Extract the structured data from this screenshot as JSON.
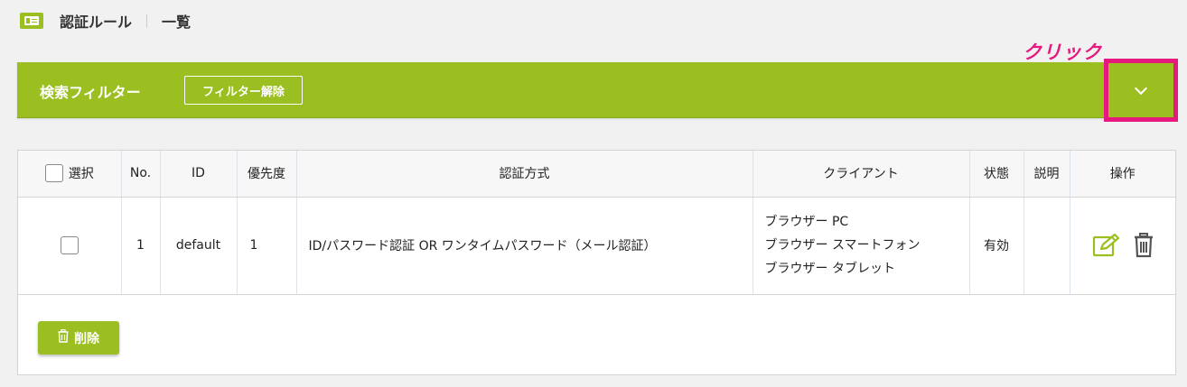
{
  "header": {
    "title": "認証ルール",
    "subtitle": "一覧"
  },
  "annotation": {
    "click_label": "クリック",
    "color": "#e6197e"
  },
  "filter": {
    "title": "検索フィルター",
    "clear_label": "フィルター解除",
    "toggle_icon": "chevron-down-icon",
    "accent": "#9bbf21"
  },
  "table": {
    "headers": {
      "select": "選択",
      "no": "No.",
      "id": "ID",
      "priority": "優先度",
      "method": "認証方式",
      "client": "クライアント",
      "status": "状態",
      "description": "説明",
      "actions": "操作"
    },
    "rows": [
      {
        "no": "1",
        "id": "default",
        "priority": "1",
        "method": "ID/パスワード認証 OR ワンタイムパスワード（メール認証）",
        "clients": [
          "ブラウザー PC",
          "ブラウザー スマートフォン",
          "ブラウザー タブレット"
        ],
        "status": "有効",
        "description": ""
      }
    ]
  },
  "actions": {
    "delete_label": "削除",
    "delete_icon": "trash-icon"
  }
}
